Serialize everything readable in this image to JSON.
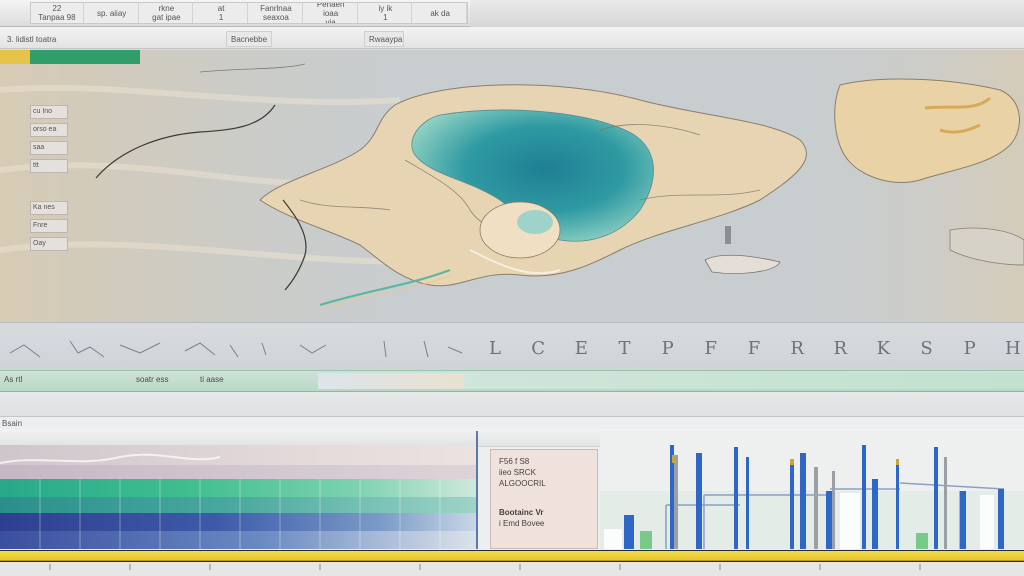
{
  "menu": {
    "items": [
      {
        "label": "22\nTanpaa 98"
      },
      {
        "label": "sp. aiiay"
      },
      {
        "label": "rkne\ngat ipae"
      },
      {
        "label": "at\n1"
      },
      {
        "label": "Fanrlnaa\nseaxoa"
      },
      {
        "label": "Penaen ioaa\nvia"
      },
      {
        "label": "iy ik\n1"
      },
      {
        "label": "ak da"
      }
    ]
  },
  "tabs": {
    "items": [
      {
        "label": "3. lidistl toatra"
      },
      {
        "label": "Bacnebbe"
      },
      {
        "label": "Rwaaypa"
      }
    ]
  },
  "map": {
    "side_chips": [
      {
        "label": "cu Ino"
      },
      {
        "label": "orso ea"
      },
      {
        "label": "saa"
      },
      {
        "label": "ttt"
      },
      {
        "label": "Ka nes"
      },
      {
        "label": "Fnre"
      },
      {
        "label": "Oay"
      }
    ],
    "colors": {
      "water_deep": "#2f8f9e",
      "water_shallow": "#7dc6c0",
      "land": "#e9d6b4",
      "land_edge": "#8c7d6a",
      "haze": "#d8c6a8"
    }
  },
  "ruler": {
    "labels": [
      "L",
      "C",
      "E",
      "T",
      "P",
      "F",
      "F",
      "R",
      "R",
      "K",
      "S",
      "P",
      "H"
    ]
  },
  "statusbar": {
    "items": [
      {
        "label": "As rtl"
      },
      {
        "label": "soatr ess"
      },
      {
        "label": "ti aase"
      }
    ]
  },
  "panel": {
    "title": "Bsain",
    "legend": [
      {
        "label": "F56  f S8"
      },
      {
        "label": "iieo  SRCK"
      },
      {
        "label": "ALGOOCRIL"
      },
      {
        "label": "Bootainc Vr"
      },
      {
        "label": "i Emd Bovee"
      }
    ]
  }
}
